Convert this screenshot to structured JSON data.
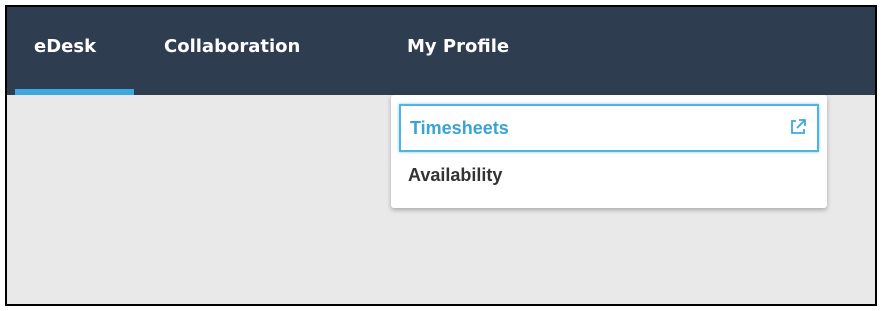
{
  "nav": {
    "items": [
      {
        "label": "eDesk",
        "active": true
      },
      {
        "label": "Collaboration",
        "active": false
      },
      {
        "label": "My Profile",
        "active": false
      }
    ]
  },
  "dropdown": {
    "items": [
      {
        "label": "Timesheets",
        "icon": "external-link-icon",
        "highlighted": true
      },
      {
        "label": "Availability"
      }
    ]
  },
  "colors": {
    "navbar_bg": "#2f3d50",
    "accent": "#3ba9dd",
    "content_bg": "#e9e9e9"
  }
}
